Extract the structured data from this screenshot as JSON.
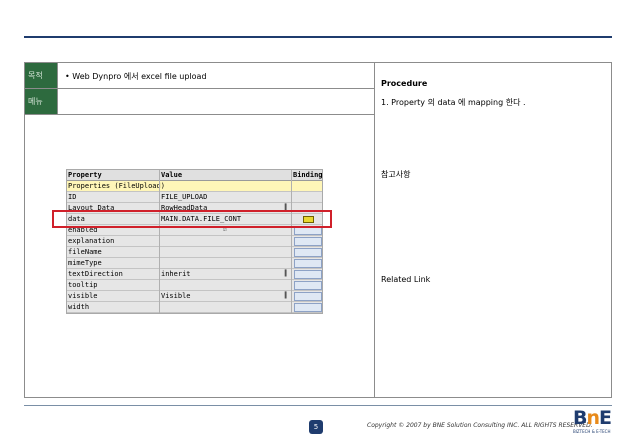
{
  "layout_labels": {
    "purpose": "목적",
    "menu": "메뉴"
  },
  "purpose": {
    "bullet": "•",
    "text": "Web Dynpro 에서 excel file upload"
  },
  "menu": {
    "text": ""
  },
  "right_panel": {
    "procedure_title": "Procedure",
    "procedure_step": "1. Property 의 data 에 mapping 한다 .",
    "reference_title": "참고사항",
    "related_link_title": "Related Link"
  },
  "property_table": {
    "headers": {
      "property": "Property",
      "value": "Value",
      "binding": "Binding"
    },
    "rows": [
      {
        "property": "Properties (FileUpload)",
        "value": "",
        "highlight": true,
        "binding": false
      },
      {
        "property": "ID",
        "value": "FILE_UPLOAD",
        "binding": false
      },
      {
        "property": "Layout Data",
        "value": "RowHeadData",
        "binding": false
      },
      {
        "property": "data",
        "value": "MAIN.DATA.FILE_CONT",
        "binding": true
      },
      {
        "property": "enabled",
        "value": "",
        "binding": true
      },
      {
        "property": "explanation",
        "value": "",
        "binding": true
      },
      {
        "property": "fileName",
        "value": "",
        "binding": true
      },
      {
        "property": "mimeType",
        "value": "",
        "binding": true
      },
      {
        "property": "textDirection",
        "value": "inherit",
        "binding": true
      },
      {
        "property": "tooltip",
        "value": "",
        "binding": true
      },
      {
        "property": "visible",
        "value": "Visible",
        "binding": true
      },
      {
        "property": "width",
        "value": "",
        "binding": true
      }
    ]
  },
  "footer": {
    "page_number": "5",
    "copyright": "Copyright © 2007 by BNE Solution Consulting INC.   ALL RIGHTS RESERVED.",
    "logo_text": "BnE",
    "logo_subtext": "BIZTECH & E-TECH"
  },
  "colors": {
    "header_rule": "#1f3c6e",
    "label_bg": "#2d6a3e",
    "highlight": "#d0202a",
    "logo_accent": "#e88a1a"
  }
}
